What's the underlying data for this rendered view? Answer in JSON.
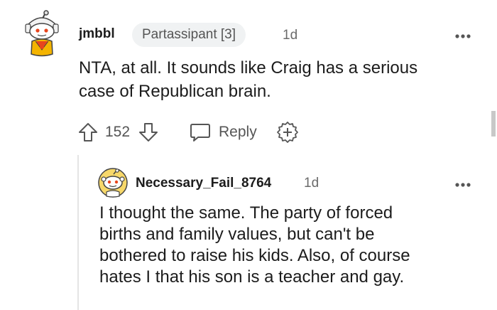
{
  "comment": {
    "username": "jmbbl",
    "flair": "Partassipant [3]",
    "timestamp": "1d",
    "lines": [
      "NTA, at all. It sounds like Craig has a serious",
      "case of Republican brain."
    ],
    "score": "152",
    "reply_label": "Reply",
    "icons": {
      "avatar": "snoo-avatar-icon",
      "upvote": "upvote-arrow-icon",
      "downvote": "downvote-arrow-icon",
      "reply": "speech-bubble-icon",
      "award": "award-plus-icon",
      "more": "more-options-icon"
    }
  },
  "reply": {
    "username": "Necessary_Fail_8764",
    "timestamp": "1d",
    "lines": [
      "I thought the same. The party of forced",
      "births and family values, but can't be",
      "bothered to raise his kids. Also, of course",
      "hates I that his son is a teacher and gay."
    ],
    "icons": {
      "avatar": "snoo-avatar-icon",
      "more": "more-options-icon"
    }
  },
  "colors": {
    "text": "#1c1c1c",
    "muted": "#6b6b6b",
    "flair_bg": "#f0f2f3",
    "thread_line": "#e4e4e4"
  }
}
